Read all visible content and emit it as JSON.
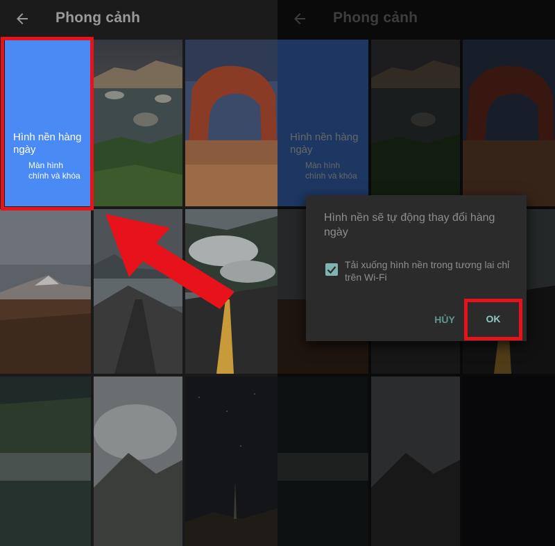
{
  "appbar": {
    "title": "Phong cảnh"
  },
  "daily_wallpaper": {
    "title": "Hình nền hàng ngày",
    "subtitle": "Màn hình chính và khóa"
  },
  "dialog": {
    "title": "Hình nền sẽ tự động thay đổi hàng ngày",
    "checkbox_label": "Tải xuống hình nền trong tương lai chỉ trên Wi-Fi",
    "checkbox_checked": true,
    "cancel_label": "HỦY",
    "ok_label": "OK"
  },
  "colors": {
    "highlight": "#e8121b",
    "daily_tile": "#4a8af4",
    "accent": "#7fb4b0"
  },
  "icons": {
    "back": "arrow-left-icon",
    "refresh": "refresh-icon",
    "check": "checkmark-icon",
    "annotation": "red-arrow-icon"
  }
}
